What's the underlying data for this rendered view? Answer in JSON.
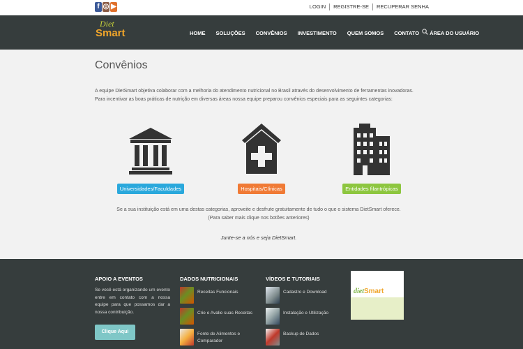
{
  "topbar": {
    "social": [
      "f",
      "◎",
      "▶"
    ],
    "links": [
      "LOGIN",
      "REGISTRE-SE",
      "RECUPERAR SENHA"
    ]
  },
  "header": {
    "logo_line1": "Diet",
    "logo_line2": "Smart",
    "nav": [
      "HOME",
      "SOLUÇÕES",
      "CONVÊNIOS",
      "INVESTIMENTO",
      "QUEM SOMOS",
      "CONTATO",
      "ÁREA DO USUÁRIO"
    ],
    "search_icon": "search-icon"
  },
  "main": {
    "title": "Convênios",
    "intro_1": "A equipe DietSmart objetiva colaborar com a melhoria do atendimento nutricional no Brasil através do desenvolvimento de ferramentas inovadoras.",
    "intro_2": "Para incentivar as boas práticas de nutrição em diversas áreas nossa equipe preparou convênios especiais para as seguintes categorias:",
    "categories": [
      {
        "label": "Universidades/Faculdades",
        "icon": "university-icon",
        "color": "#2aa8dc"
      },
      {
        "label": "Hospitais/Clínicas",
        "icon": "hospital-icon",
        "color": "#f07a35"
      },
      {
        "label": "Entidades filantrópicas",
        "icon": "buildings-icon",
        "color": "#8dc63f"
      }
    ],
    "note_1": "Se a sua instituição está em uma destas categorias, aproveite e desfrute gratuitamente de tudo o que o sistema DietSmart oferece.",
    "note_2": "(Para saber mais clique nos botões anteriores)",
    "join": "Junte-se a nós e seja DietSmart."
  },
  "footer": {
    "apoio_title": "APOIO A EVENTOS",
    "apoio_text": "Se você está organizando um evento entre em contato com a nossa equipe para que possamos dar a nossa contribuição.",
    "apoio_button": "Clique Aqui",
    "dados_title": "DADOS NUTRICIONAIS",
    "dados_items": [
      "Receitas Funcionais",
      "Crie e Avalie suas Receitas",
      "Fonte de Alimentos e Comparador"
    ],
    "videos_title": "VÍDEOS E TUTORIAIS",
    "videos_items": [
      "Cadastro e Download",
      "Instalação e Utilização",
      "Backup de Dados"
    ],
    "badge_logo_1": "diet",
    "badge_logo_2": "Smart"
  }
}
